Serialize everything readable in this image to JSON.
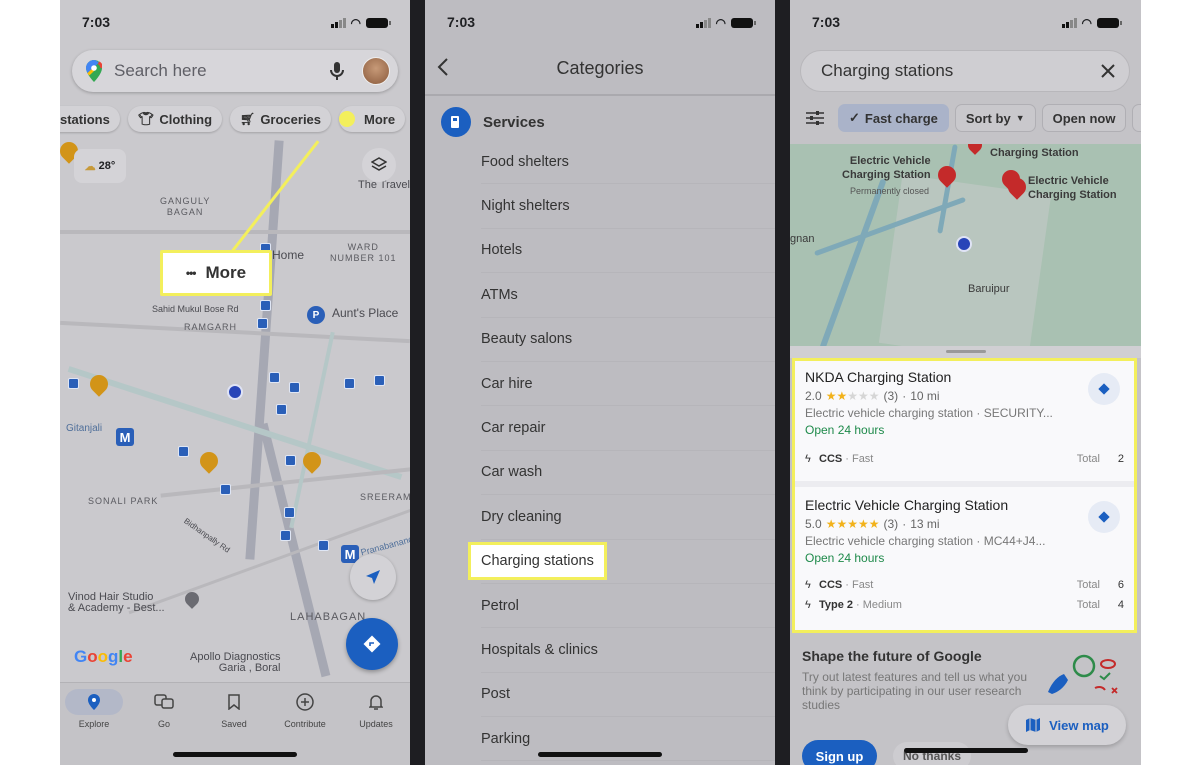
{
  "status_bar": {
    "time": "7:03"
  },
  "panel_explore": {
    "search": {
      "placeholder": "Search here"
    },
    "chips": [
      {
        "label": "stations",
        "icon": "ev-station-icon"
      },
      {
        "label": "Clothing",
        "icon": "shirt-icon"
      },
      {
        "label": "Groceries",
        "icon": "cart-icon"
      },
      {
        "label": "More",
        "icon": "more-dots-icon"
      }
    ],
    "weather": {
      "temp": "28°"
    },
    "callout": {
      "dots": "•••",
      "label": "More"
    },
    "map_labels": {
      "ganguly_bagan": "GANGULY\nBAGAN",
      "home": "Home",
      "ward": "WARD\nNUMBER 101",
      "sahid_road": "Sahid Mukul Bose Rd",
      "ramgarh": "RAMGARH",
      "aunts_place": "Aunt's Place",
      "gitanjali": "Gitanjali",
      "sonali_park": "SONALI PARK",
      "bidhanpally": "Bidhanpally Rd",
      "sreerampur": "SREERAM",
      "pranabananda": "Pranabananda",
      "vinod": "Vinod Hair Studio\n& Academy - Best...",
      "lahabagan": "LAHABAGAN",
      "apollo": "Apollo Diagnostics\nGaria , Boral",
      "the_travel": "The Travel"
    },
    "google_logo": "Google",
    "nav": [
      {
        "label": "Explore",
        "icon": "location-pin-icon",
        "active": true
      },
      {
        "label": "Go",
        "icon": "commute-icon",
        "active": false
      },
      {
        "label": "Saved",
        "icon": "bookmark-icon",
        "active": false
      },
      {
        "label": "Contribute",
        "icon": "add-circle-icon",
        "active": false
      },
      {
        "label": "Updates",
        "icon": "bell-icon",
        "active": false
      }
    ]
  },
  "panel_categories": {
    "title": "Categories",
    "section": "Services",
    "items": [
      "Food shelters",
      "Night shelters",
      "Hotels",
      "ATMs",
      "Beauty salons",
      "Car hire",
      "Car repair",
      "Car wash",
      "Dry cleaning",
      "Charging stations",
      "Petrol",
      "Hospitals & clinics",
      "Post",
      "Parking"
    ],
    "highlighted": "Charging stations"
  },
  "panel_results": {
    "query": "Charging stations",
    "filters": [
      {
        "label": "Fast charge",
        "active": true
      },
      {
        "label": "Sort by",
        "dropdown": true
      },
      {
        "label": "Open now"
      }
    ],
    "map_labels": {
      "ev1": "Electric Vehicle\nCharging Station",
      "ev1_status": "Permanently closed",
      "top": "Charging Station",
      "ev2": "Electric Vehicle\nCharging Station",
      "baruipur": "Baruipur",
      "left_edge": "gnan"
    },
    "results": [
      {
        "name": "NKDA Charging Station",
        "rating": "2.0",
        "stars": 2,
        "reviews": "(3)",
        "distance": "10 mi",
        "description": "Electric vehicle charging station · SECURITY...",
        "hours": "Open 24 hours",
        "connectors": [
          {
            "type": "CCS",
            "speed": "Fast",
            "total_label": "Total",
            "count": "2"
          }
        ]
      },
      {
        "name": "Electric Vehicle Charging Station",
        "rating": "5.0",
        "stars": 5,
        "reviews": "(3)",
        "distance": "13 mi",
        "description": "Electric vehicle charging station · MC44+J4...",
        "hours": "Open 24 hours",
        "connectors": [
          {
            "type": "CCS",
            "speed": "Fast",
            "total_label": "Total",
            "count": "6"
          },
          {
            "type": "Type 2",
            "speed": "Medium",
            "total_label": "Total",
            "count": "4"
          }
        ]
      }
    ],
    "promo": {
      "title": "Shape the future of Google",
      "text": "Try out latest features and tell us what you think by participating in our user research studies",
      "signup": "Sign up",
      "no_thanks": "No thanks"
    },
    "view_map": "View map"
  },
  "colors": {
    "highlight": "#f3ef5c",
    "accent_blue": "#1b5fc0",
    "open_green": "#1e8a4a",
    "star": "#f2b21b",
    "pin_red": "#c42a2a"
  }
}
